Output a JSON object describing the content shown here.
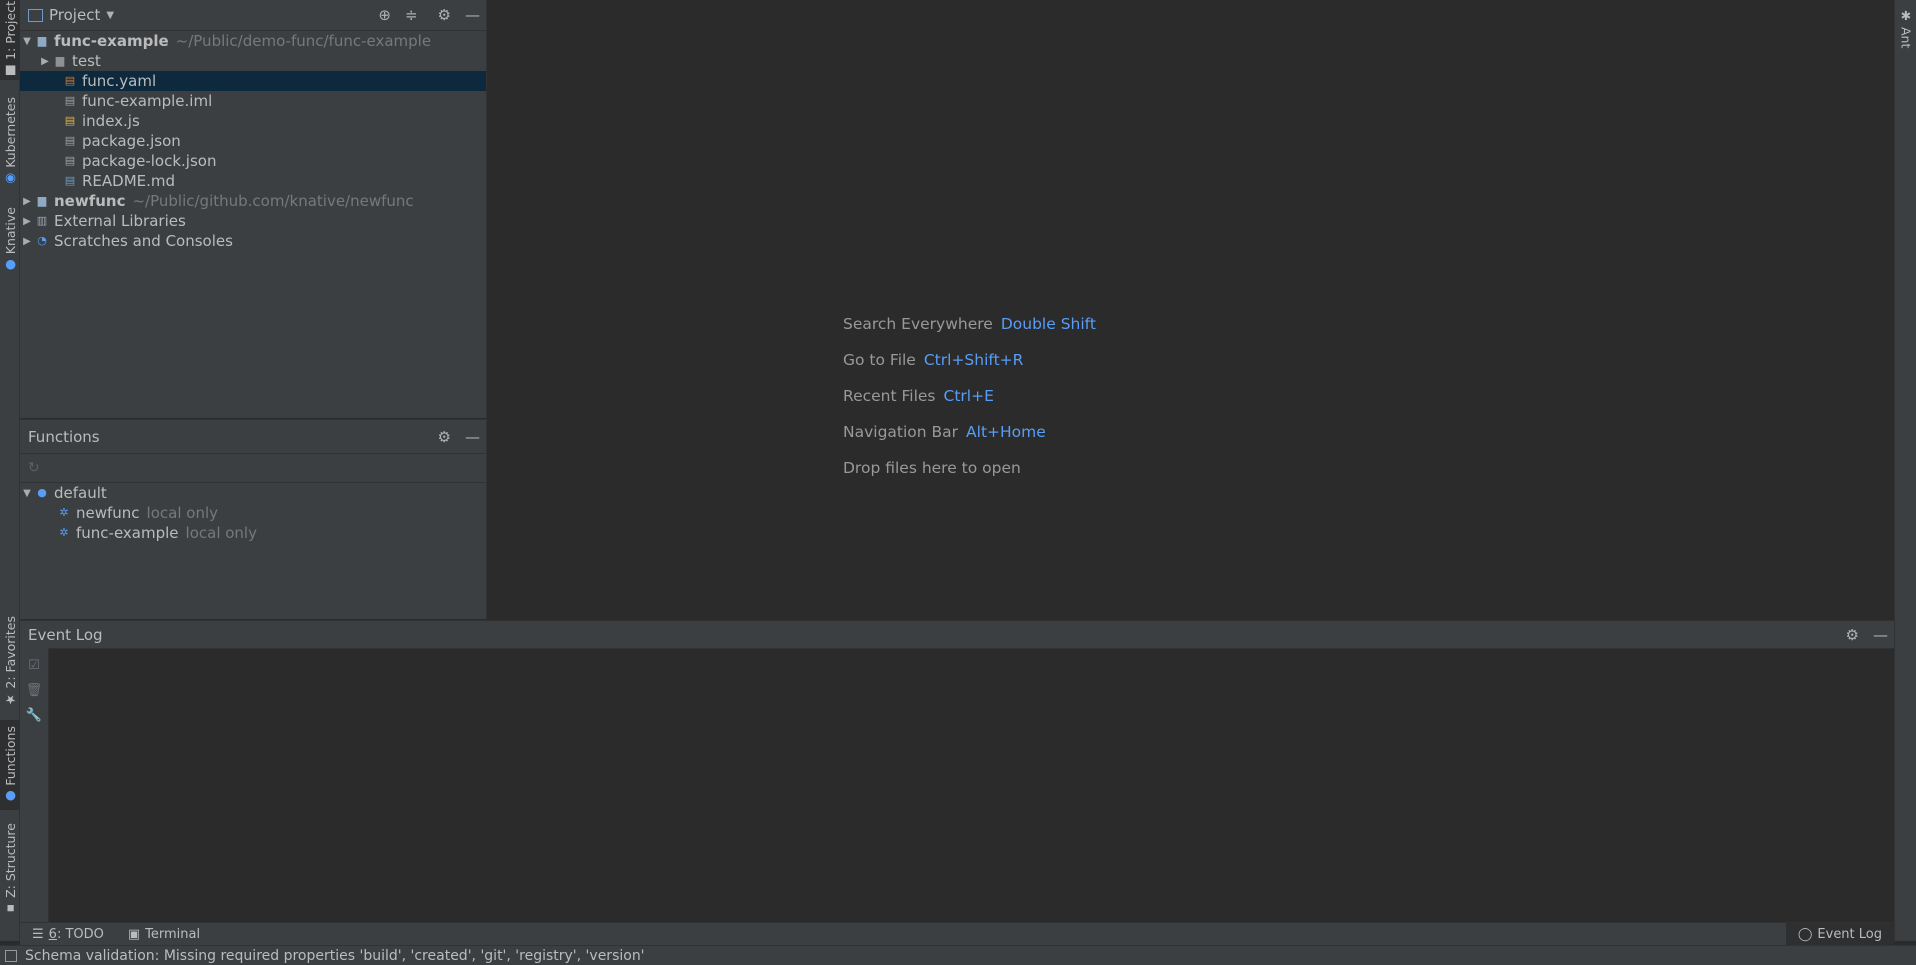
{
  "left_strip": {
    "tabs": [
      {
        "label": "1: Project"
      },
      {
        "label": "Kubernetes"
      },
      {
        "label": "Knative"
      },
      {
        "label": "2: Favorites"
      },
      {
        "label": "Functions"
      },
      {
        "label": "Z: Structure"
      }
    ]
  },
  "right_strip": {
    "tab": "Ant"
  },
  "project": {
    "title": "Project",
    "tree": [
      {
        "label": "func-example",
        "path": "~/Public/demo-func/func-example"
      },
      {
        "label": "test"
      },
      {
        "label": "func.yaml"
      },
      {
        "label": "func-example.iml"
      },
      {
        "label": "index.js"
      },
      {
        "label": "package.json"
      },
      {
        "label": "package-lock.json"
      },
      {
        "label": "README.md"
      },
      {
        "label": "newfunc",
        "path": "~/Public/github.com/knative/newfunc"
      },
      {
        "label": "External Libraries"
      },
      {
        "label": "Scratches and Consoles"
      }
    ]
  },
  "functions": {
    "title": "Functions",
    "tree": [
      {
        "label": "default"
      },
      {
        "label": "newfunc",
        "status": "local only"
      },
      {
        "label": "func-example",
        "status": "local only"
      }
    ]
  },
  "editor": {
    "hints": [
      {
        "label": "Search Everywhere",
        "key": "Double Shift"
      },
      {
        "label": "Go to File",
        "key": "Ctrl+Shift+R"
      },
      {
        "label": "Recent Files",
        "key": "Ctrl+E"
      },
      {
        "label": "Navigation Bar",
        "key": "Alt+Home"
      },
      {
        "label": "Drop files here to open",
        "key": ""
      }
    ]
  },
  "event_log": {
    "title": "Event Log"
  },
  "bottom_tabs": {
    "todo_num": "6",
    "todo_label": ": TODO",
    "terminal": "Terminal",
    "event_log": "Event Log"
  },
  "status": {
    "message": "Schema validation: Missing required properties 'build', 'created', 'git', 'registry', 'version'"
  },
  "colors": {
    "accent": "#589df6",
    "selection": "#0d293e",
    "panel": "#3c3f41",
    "editor": "#2b2b2b"
  }
}
